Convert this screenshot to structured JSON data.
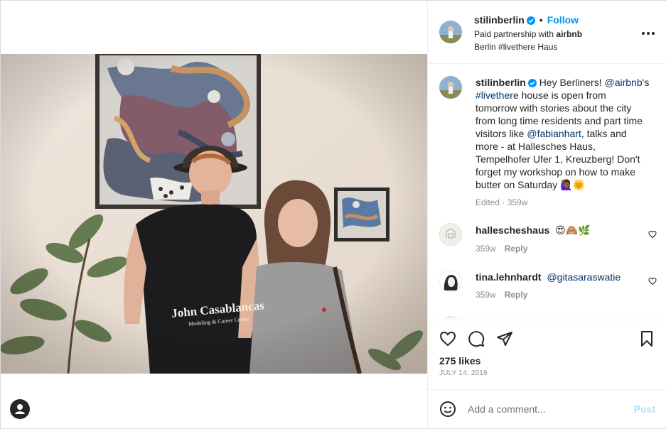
{
  "post": {
    "username": "stilinberlin",
    "follow_label": "Follow",
    "paid_partnership_prefix": "Paid partnership with",
    "partner": "airbnb",
    "location": "Berlin #livethere Haus"
  },
  "caption": {
    "username": "stilinberlin",
    "t1": "Hey Berliners! ",
    "m1": "@airbnb",
    "t2": "'s ",
    "m2": "#livethere",
    "t3": " house is open from tomorrow with stories about the city from long time residents and part time visitors like ",
    "m3": "@fabianhart",
    "t4": ", talks and more - at Hallesches Haus, Tempelhofer Ufer 1, Kreuzberg! Don't forget my workshop on how to make butter on Saturday 🙋🏾‍♀️🌞",
    "edited": "Edited · 359w"
  },
  "comments": [
    {
      "username": "hallescheshaus",
      "text": "😍🙈🌿",
      "time": "359w",
      "reply": "Reply"
    },
    {
      "username": "tina.lehnhardt",
      "text": "@gitasaraswatie",
      "time": "359w",
      "reply": "Reply"
    }
  ],
  "stats": {
    "likes": "275 likes",
    "date": "JULY 14, 2016"
  },
  "composer": {
    "placeholder": "Add a comment...",
    "post_label": "Post"
  },
  "photo": {
    "shirt_line1": "John Casablancas",
    "shirt_line2": "Modeling & Career Center"
  },
  "colors": {
    "accent": "#0095f6",
    "link": "#00376b",
    "muted": "#8e8e8e",
    "post_disabled": "#b2dffc"
  },
  "icons": [
    "verified-badge-icon",
    "more-options-icon",
    "heart-icon",
    "comment-icon",
    "share-icon",
    "bookmark-icon",
    "emoji-icon",
    "user-tag-icon"
  ]
}
